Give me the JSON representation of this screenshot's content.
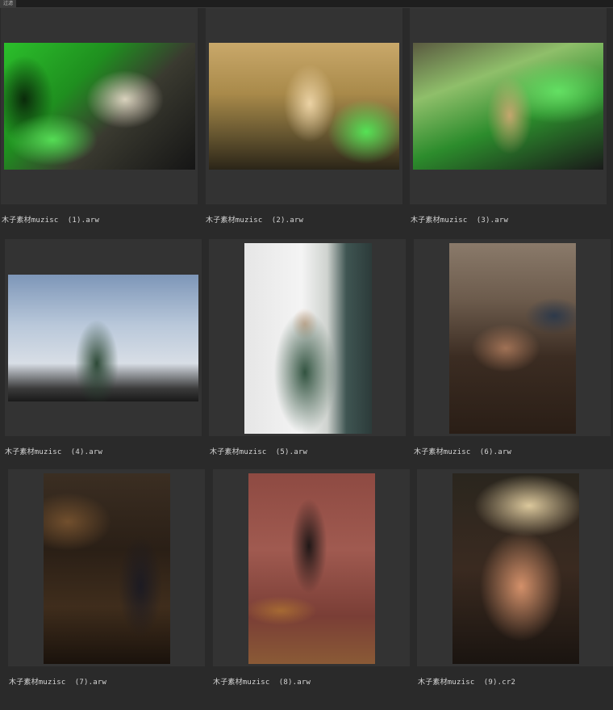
{
  "toolbar": {
    "tab_label": "过滤"
  },
  "items": [
    {
      "caption": "木子素材muzisc  (1).arw",
      "orientation": "landscape"
    },
    {
      "caption": "木子素材muzisc  (2).arw",
      "orientation": "landscape"
    },
    {
      "caption": "木子素材muzisc  (3).arw",
      "orientation": "landscape"
    },
    {
      "caption": "木子素材muzisc  (4).arw",
      "orientation": "landscape"
    },
    {
      "caption": "木子素材muzisc  (5).arw",
      "orientation": "portrait"
    },
    {
      "caption": "木子素材muzisc  (6).arw",
      "orientation": "portrait"
    },
    {
      "caption": "木子素材muzisc  (7).arw",
      "orientation": "portrait"
    },
    {
      "caption": "木子素材muzisc  (8).arw",
      "orientation": "portrait"
    },
    {
      "caption": "木子素材muzisc  (9).cr2",
      "orientation": "portrait"
    }
  ]
}
